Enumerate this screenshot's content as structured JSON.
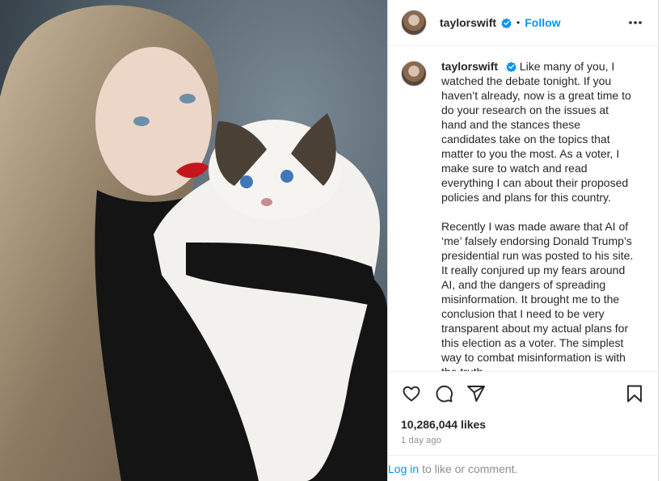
{
  "post": {
    "image_alt": "Woman with long wavy hair holding a ragdoll cat"
  },
  "header": {
    "username": "taylorswift",
    "separator": "•",
    "follow_label": "Follow",
    "more_icon": "more-horizontal-icon"
  },
  "caption": {
    "username": "taylorswift",
    "paragraphs": [
      "Like many of you, I watched the debate tonight. If you haven’t already, now is a great time to do your research on the issues at hand and the stances these candidates take on the topics that matter to you the most. As a voter, I make sure to watch and read everything I can about their proposed policies and plans for this country.",
      "Recently I was made aware that AI of ‘me’ falsely endorsing Donald Trump’s presidential run was posted to his site. It really conjured up my fears around AI, and the dangers of spreading misinformation. It brought me to the conclusion that I need to be very transparent about my actual plans for this election as a voter. The simplest way to combat misinformation is with the truth."
    ]
  },
  "actions": {
    "like_icon": "heart-icon",
    "comment_icon": "comment-icon",
    "share_icon": "send-icon",
    "save_icon": "bookmark-icon",
    "likes_text": "10,286,044 likes",
    "time_text": "1 day ago"
  },
  "login": {
    "link_label": "Log in",
    "rest_text": "to like or comment."
  },
  "colors": {
    "accent": "#0095f6",
    "text": "#262626",
    "muted": "#8e8e8e",
    "verified": "#0095f6"
  }
}
